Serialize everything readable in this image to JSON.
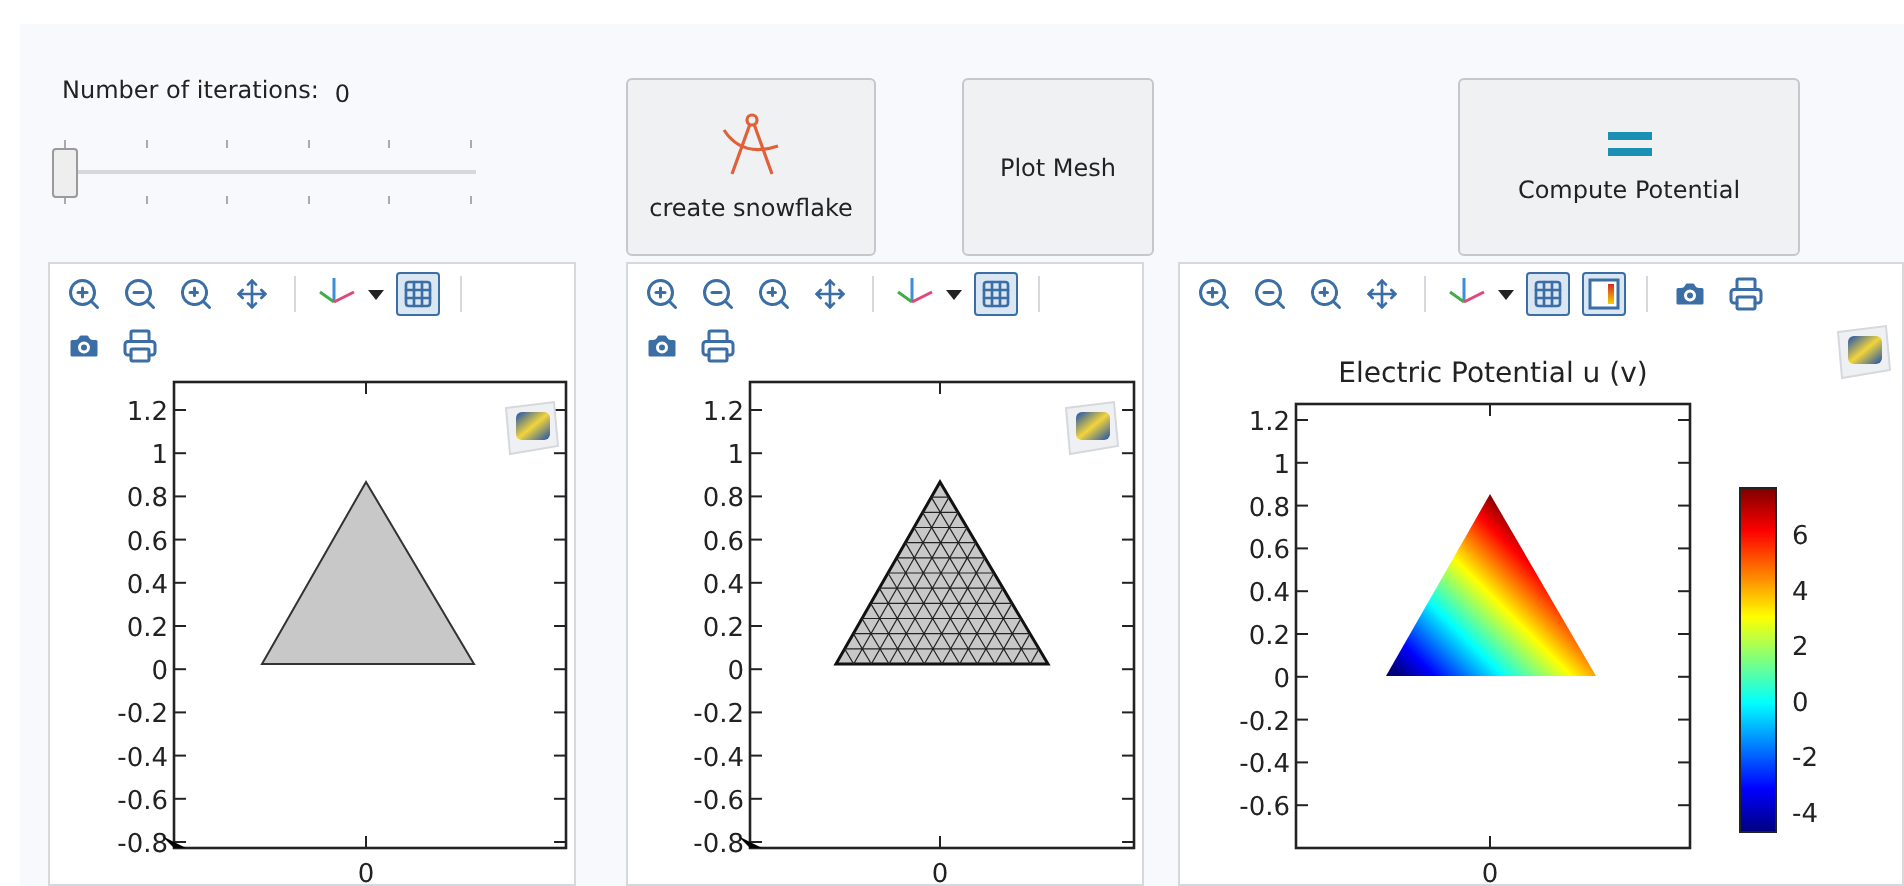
{
  "slider": {
    "label": "Number of iterations:",
    "value": "0",
    "level": 0
  },
  "buttons": [
    {
      "label": "create snowflake",
      "kind": "compass"
    },
    {
      "label": "Plot Mesh",
      "kind": "plain"
    },
    {
      "label": "Compute Potential",
      "kind": "equals"
    }
  ],
  "plots": [
    {
      "kind": "geometry",
      "grid_on": true,
      "yticks": [
        "1.2",
        "1",
        "0.8",
        "0.6",
        "0.4",
        "0.2",
        "0",
        "-0.2",
        "-0.4",
        "-0.6",
        "-0.8"
      ],
      "xticks": [
        "0"
      ]
    },
    {
      "kind": "mesh",
      "grid_on": true,
      "yticks": [
        "1.2",
        "1",
        "0.8",
        "0.6",
        "0.4",
        "0.2",
        "0",
        "-0.2",
        "-0.4",
        "-0.6",
        "-0.8"
      ],
      "xticks": [
        "0"
      ]
    },
    {
      "kind": "potential",
      "grid_on": true,
      "legend_on": true,
      "title": "Electric Potential u (v)",
      "yticks": [
        "1.2",
        "1",
        "0.8",
        "0.6",
        "0.4",
        "0.2",
        "0",
        "-0.2",
        "-0.4",
        "-0.6"
      ],
      "xticks": [
        "0"
      ],
      "colorbar_ticks": [
        "6",
        "4",
        "2",
        "0",
        "-2",
        "-4"
      ]
    }
  ]
}
